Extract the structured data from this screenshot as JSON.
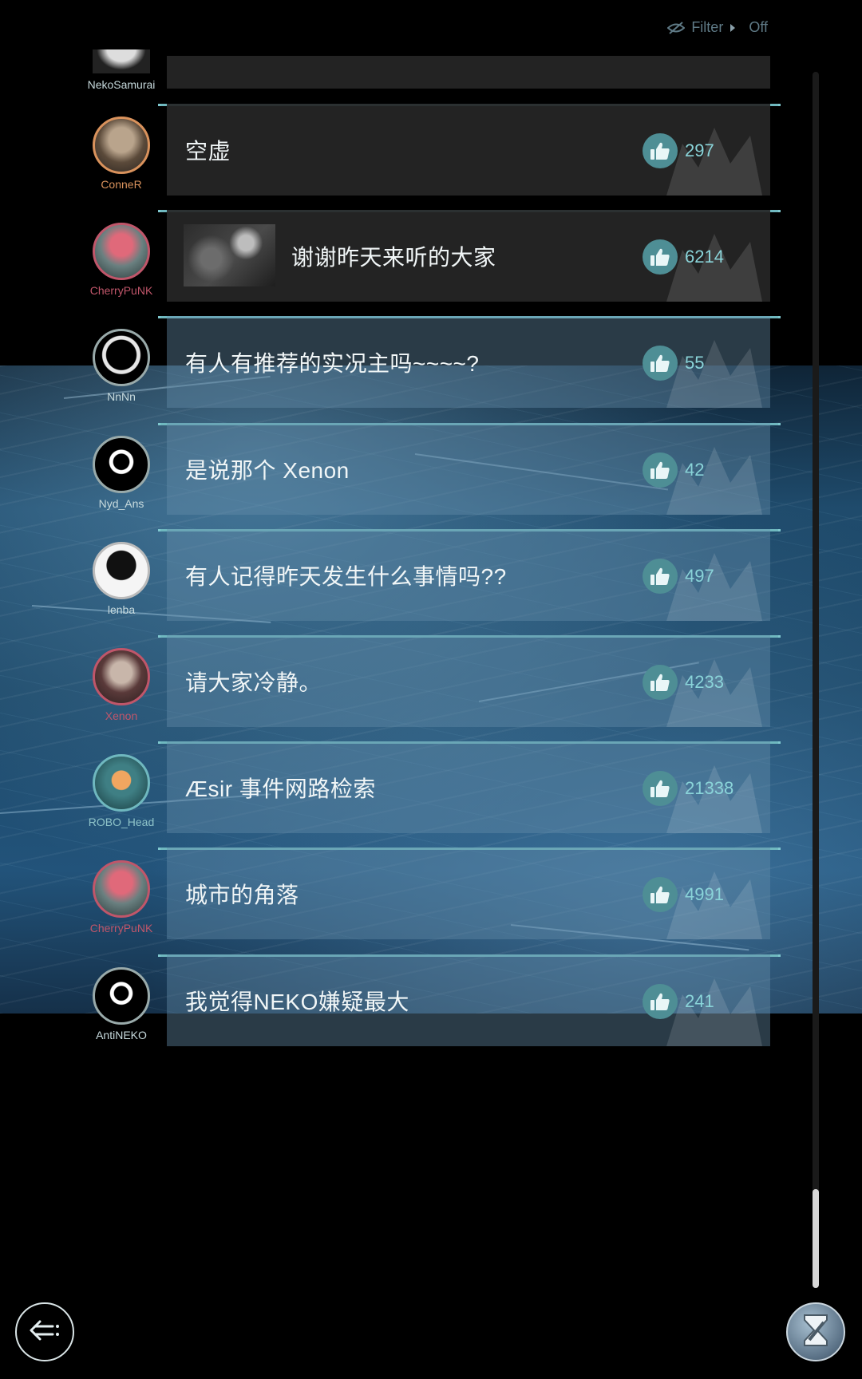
{
  "filter": {
    "label": "Filter",
    "value": "Off"
  },
  "top_user": "NekoSamurai",
  "posts": [
    {
      "user": "ConneR",
      "user_color": "#d9925c",
      "title": "空虚",
      "likes": "297",
      "thumb": false
    },
    {
      "user": "CherryPuNK",
      "user_color": "#c0566a",
      "title": "谢谢昨天来听的大家",
      "likes": "6214",
      "thumb": true
    },
    {
      "user": "NnNn",
      "user_color": "#c7dadd",
      "title": "有人有推荐的实况主吗~~~~?",
      "likes": "55",
      "thumb": false
    },
    {
      "user": "Nyd_Ans",
      "user_color": "#c7dadd",
      "title": "是说那个 Xenon",
      "likes": "42",
      "thumb": false
    },
    {
      "user": "lenba",
      "user_color": "#c7dadd",
      "title": "有人记得昨天发生什么事情吗??",
      "likes": "497",
      "thumb": false
    },
    {
      "user": "Xenon",
      "user_color": "#c0566a",
      "title": "请大家冷静。",
      "likes": "4233",
      "thumb": false
    },
    {
      "user": "ROBO_Head",
      "user_color": "#8fc4c9",
      "title": "Æsir 事件网路检索",
      "likes": "21338",
      "thumb": false
    },
    {
      "user": "CherryPuNK",
      "user_color": "#c0566a",
      "title": "城市的角落",
      "likes": "4991",
      "thumb": false
    },
    {
      "user": "AntiNEKO",
      "user_color": "#c7dadd",
      "title": "我觉得NEKO嫌疑最大",
      "likes": "241",
      "thumb": false
    }
  ],
  "icons": {
    "filter": "eye-slash-icon",
    "like": "thumbs-up-icon",
    "back": "back-arrow-icon",
    "logo": "hourglass-logo-icon"
  },
  "colors": {
    "accent": "#6fb8bf",
    "like_bg": "#4e8e95",
    "count": "#8ad4d9"
  }
}
